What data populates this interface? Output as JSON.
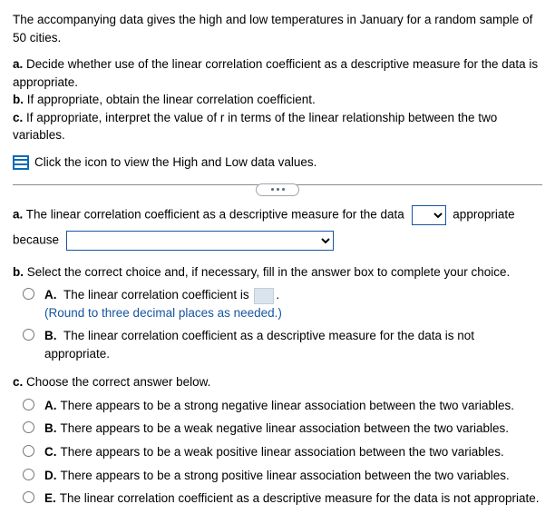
{
  "intro": "The accompanying data gives the high and low temperatures in January for a random sample of 50 cities.",
  "parts": {
    "a": "Decide whether use of the linear correlation coefficient as a descriptive measure for the data is appropriate.",
    "b": "If appropriate, obtain the linear correlation coefficient.",
    "c": "If appropriate, interpret the value of r in terms of the linear relationship between the two variables."
  },
  "link_text": "Click the icon to view the High and Low data values.",
  "qa": {
    "a_prefix": "The linear correlation coefficient as a descriptive measure for the data",
    "a_suffix": "appropriate",
    "a_because": "because"
  },
  "qb": {
    "prompt": "Select the correct choice and, if necessary, fill in the answer box to complete your choice.",
    "options": {
      "A_text": "The linear correlation coefficient is",
      "A_hint": "(Round to three decimal places as needed.)",
      "B_text": "The linear correlation coefficient as a descriptive measure for the data is not appropriate."
    }
  },
  "qc": {
    "prompt": "Choose the correct answer below.",
    "options": {
      "A": "There appears to be a strong negative linear association between the two variables.",
      "B": "There appears to be a weak negative linear association between the two variables.",
      "C": "There appears to be a weak positive linear association between the two variables.",
      "D": "There appears to be a strong positive linear association between the two variables.",
      "E": "The linear correlation coefficient as a descriptive measure for the data is not appropriate."
    }
  },
  "labels": {
    "a": "a.",
    "b": "b.",
    "c": "c.",
    "A": "A.",
    "B": "B.",
    "C": "C.",
    "D": "D.",
    "E": "E."
  }
}
